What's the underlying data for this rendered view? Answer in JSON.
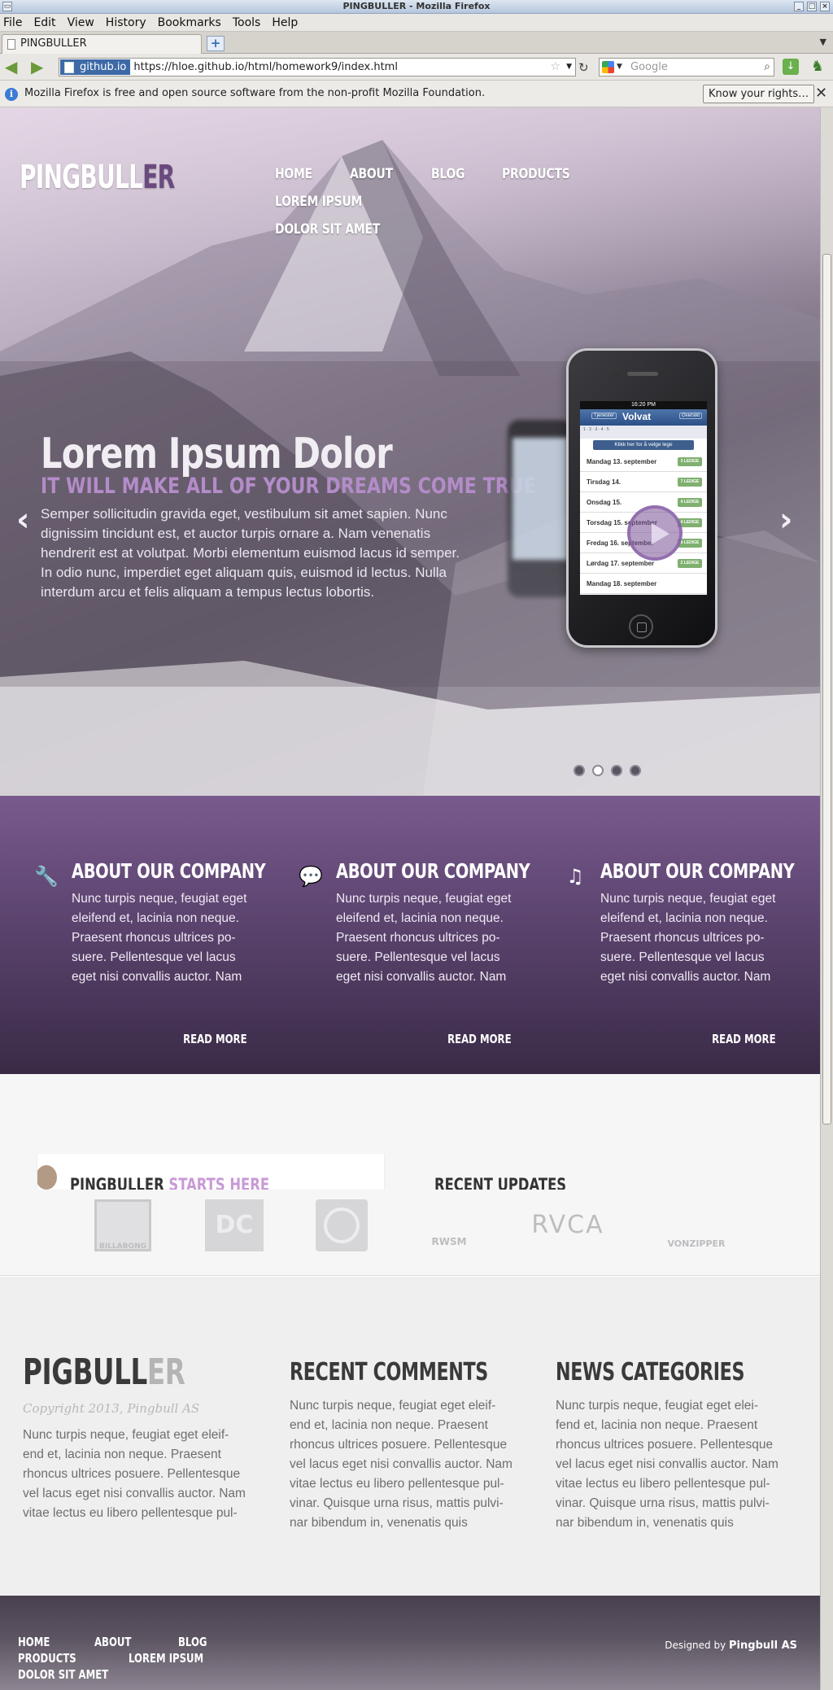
{
  "browser": {
    "window_title": "PINGBULLER - Mozilla Firefox",
    "menu": [
      "File",
      "Edit",
      "View",
      "History",
      "Bookmarks",
      "Tools",
      "Help"
    ],
    "tab_title": "PINGBULLER",
    "site_identity": "github.io",
    "url": "https://hloe.github.io/html/homework9/index.html",
    "search_placeholder": "Google",
    "infobar_text": "Mozilla Firefox is free and open source software from the non-profit Mozilla Foundation.",
    "infobar_button": "Know your rights…"
  },
  "site": {
    "logo_main": "PINGBULL",
    "logo_accent": "ER",
    "nav": [
      "HOME",
      "ABOUT",
      "BLOG",
      "PRODUCTS",
      "LOREM IPSUM",
      "DOLOR SIT AMET"
    ]
  },
  "slider": {
    "title": "Lorem Ipsum Dolor",
    "subtitle": "IT WILL MAKE ALL OF YOUR DREAMS COME TRUE",
    "text": "Semper sollicitudin gravida eget, vestibulum sit amet sapien. Nunc dignissim tincidunt est, et auctor turpis ornare a. Nam venenatis hendrerit est at volutpat. Morbi elementum euismod lacus id semper. In odio nunc, imperdiet eget aliquam quis, euismod id lectus. Nulla interdum arcu et felis aliquam a tempus lectus lobortis.",
    "prev_glyph": "‹",
    "next_glyph": "›",
    "active_dot": 2,
    "dot_count": 4,
    "phone_screen": {
      "status_time": "16:20 PM",
      "left_btn": "Tjenester",
      "brand": "Volvat",
      "right_btn": "Oversikt",
      "cta": "Klikk her for å velge lege",
      "rows": [
        "Mandag 13. september",
        "Tirsdag 14.",
        "Onsdag 15.",
        "Torsdag 15. september",
        "Fredag 16. september",
        "Lørdag 17. september",
        "Mandag 18. september"
      ],
      "badges": [
        "3 LEDIGE",
        "7 LEDIGE",
        "4 LEDIGE",
        "4 LEDIGE",
        "8 LEDIGE",
        "2 LEDIGE",
        ""
      ]
    }
  },
  "features": [
    {
      "icon": "wrench-icon",
      "glyph": "🔧",
      "title": "ABOUT OUR COMPANY",
      "text": "Nunc turpis neque, feugiat eget eleifend et, lacinia non neque. Praesent rhoncus ultrices po- suere. Pellentesque vel lacus eget nisi convallis auctor. Nam",
      "link": "READ MORE"
    },
    {
      "icon": "speech-bubble-icon",
      "glyph": "💬",
      "title": "ABOUT OUR COMPANY",
      "text": "Nunc turpis neque, feugiat eget eleifend et, lacinia non neque. Praesent rhoncus ultrices po- suere. Pellentesque vel lacus eget nisi convallis auctor. Nam",
      "link": "READ MORE"
    },
    {
      "icon": "music-note-icon",
      "glyph": "♫",
      "title": "ABOUT OUR COMPANY",
      "text": "Nunc turpis neque, feugiat eget eleifend et, lacinia non neque. Praesent rhoncus ultrices po- suere. Pellentesque vel lacus eget nisi convallis auctor. Nam",
      "link": "READ MORE"
    }
  ],
  "partners": {
    "peek_title": "PINGBULLER",
    "peek_accent": "STARTS HERE",
    "recent_updates": "RECENT UPDATES",
    "brands": [
      "BILLABONG",
      "DC",
      "ELEMENT",
      "RWSM",
      "RVCA",
      "VONZIPPER"
    ]
  },
  "footer": {
    "logo_main": "PIGBULL",
    "logo_accent": "ER",
    "copyright": "Copyright 2013, Pingbull AS",
    "about_text": "Nunc turpis neque, feugiat eget eleif- end et, lacinia non neque. Praesent rhoncus ultrices posuere. Pellentesque vel lacus eget nisi convallis auctor. Nam vitae lectus eu libero pellentesque pul-",
    "comments_title": "RECENT COMMENTS",
    "comments_text": "Nunc turpis neque, feugiat eget eleif- end et, lacinia non neque. Praesent rhoncus ultrices posuere. Pellentesque vel lacus eget nisi convallis auctor. Nam vitae lectus eu libero pellentesque pul- vinar. Quisque urna risus, mattis pulvi- nar bibendum in, venenatis quis",
    "categories_title": "NEWS CATEGORIES",
    "categories_text": "Nunc turpis neque, feugiat eget elei- fend et, lacinia non neque. Praesent rhoncus ultrices posuere. Pellentesque vel lacus eget nisi convallis auctor. Nam vitae lectus eu libero pellentesque pul- vinar. Quisque urna risus, mattis pulvi- nar bibendum in, venenatis quis"
  },
  "bottom": {
    "nav": [
      "HOME",
      "ABOUT",
      "BLOG",
      "PRODUCTS",
      "LOREM IPSUM",
      "DOLOR SIT AMET"
    ],
    "credit_prefix": "Designed by",
    "credit_name": "Pingbull AS"
  }
}
